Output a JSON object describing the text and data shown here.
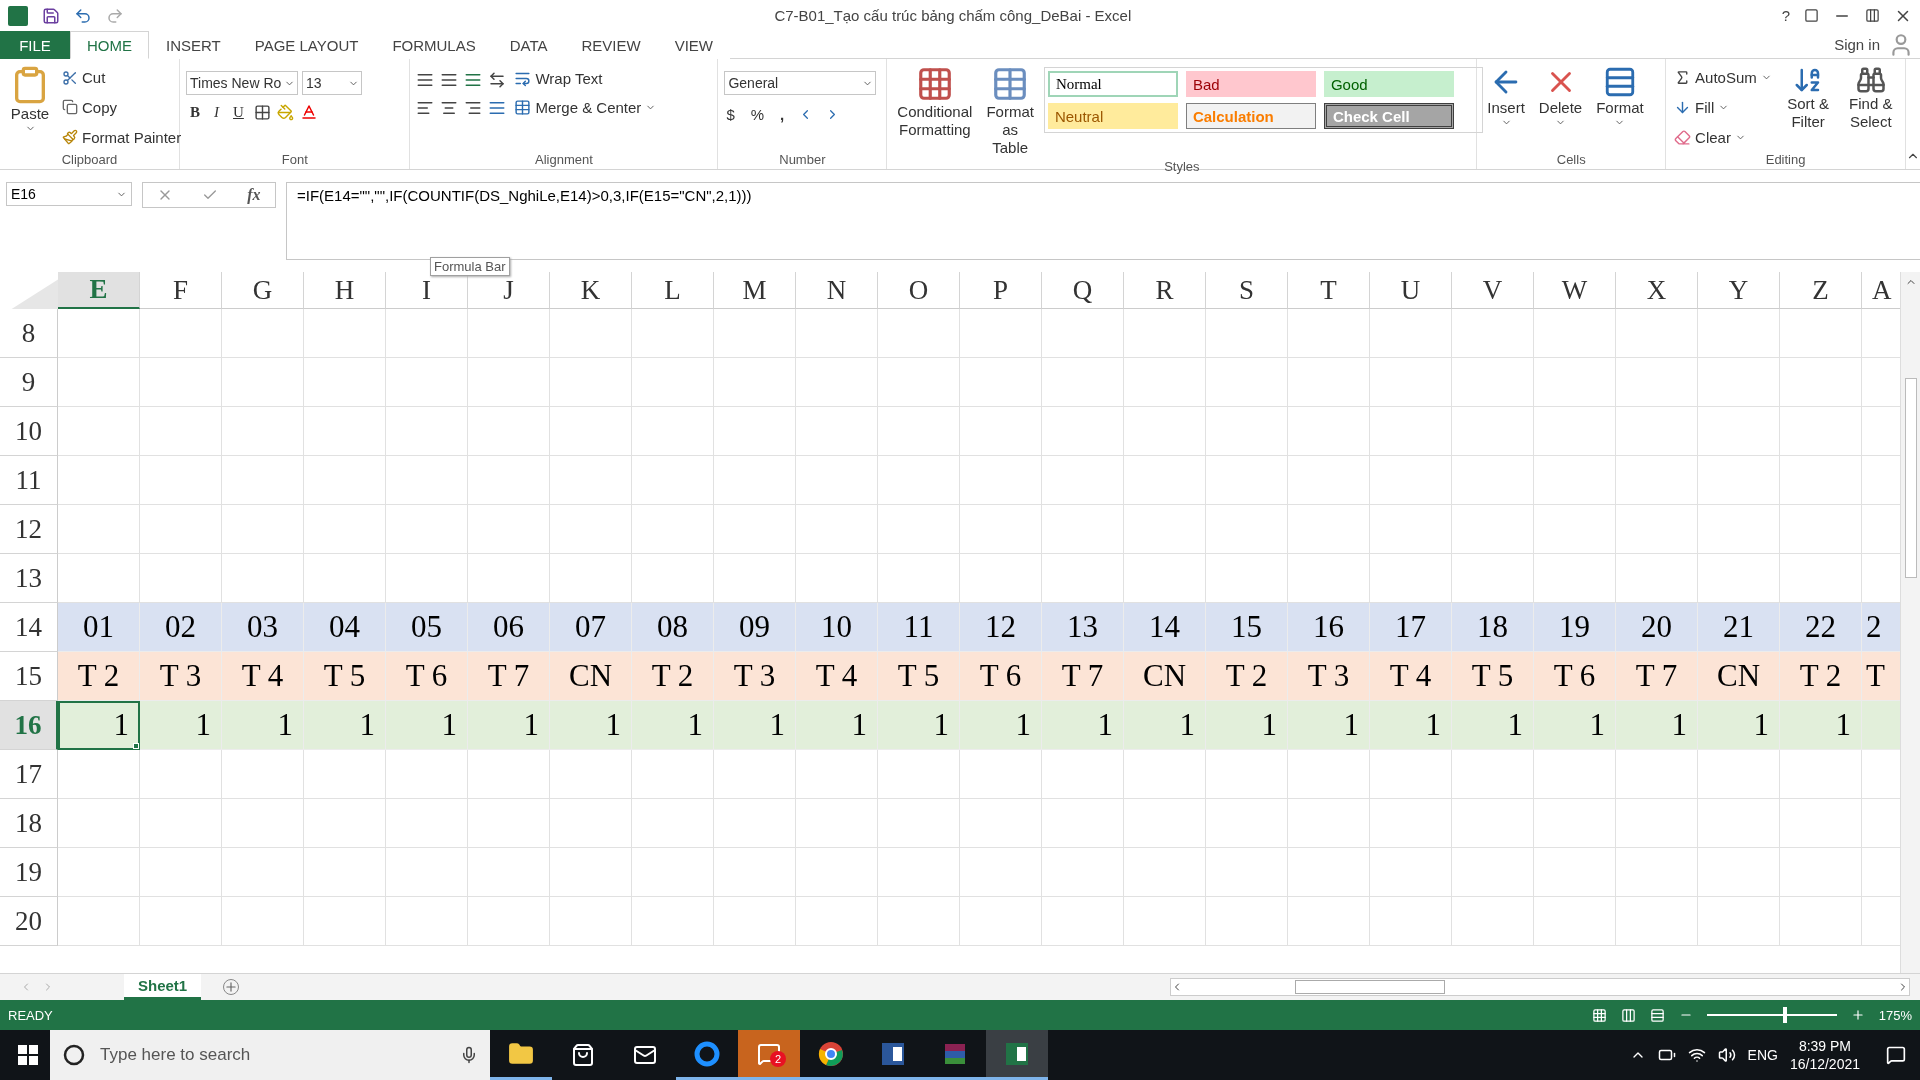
{
  "title_bar": {
    "title": "C7-B01_Tạo cấu trúc bảng chấm công_DeBai - Excel",
    "help": "?",
    "sign_in": "Sign in"
  },
  "ribbon_tabs": [
    {
      "label": "FILE",
      "kind": "file",
      "selected": false
    },
    {
      "label": "HOME",
      "kind": "tab",
      "selected": true
    },
    {
      "label": "INSERT",
      "kind": "tab",
      "selected": false
    },
    {
      "label": "PAGE LAYOUT",
      "kind": "tab",
      "selected": false
    },
    {
      "label": "FORMULAS",
      "kind": "tab",
      "selected": false
    },
    {
      "label": "DATA",
      "kind": "tab",
      "selected": false
    },
    {
      "label": "REVIEW",
      "kind": "tab",
      "selected": false
    },
    {
      "label": "VIEW",
      "kind": "tab",
      "selected": false
    }
  ],
  "ribbon": {
    "clipboard": {
      "label": "Clipboard",
      "paste": "Paste",
      "cut": "Cut",
      "copy": "Copy",
      "format_painter": "Format Painter"
    },
    "font": {
      "label": "Font",
      "name": "Times New Ro",
      "size": "13",
      "bold": "B",
      "italic": "I",
      "underline": "U"
    },
    "alignment": {
      "label": "Alignment",
      "wrap_text": "Wrap Text",
      "merge": "Merge & Center"
    },
    "number": {
      "label": "Number",
      "format": "General",
      "currency": "$",
      "percent": "%",
      "comma": ","
    },
    "styles": {
      "label": "Styles",
      "conditional": "Conditional Formatting",
      "format_table": "Format as Table",
      "gallery": [
        {
          "label": "Normal",
          "kind": "normal"
        },
        {
          "label": "Bad",
          "kind": "bad"
        },
        {
          "label": "Good",
          "kind": "good"
        },
        {
          "label": "Neutral",
          "kind": "neutral"
        },
        {
          "label": "Calculation",
          "kind": "calculation"
        },
        {
          "label": "Check Cell",
          "kind": "check"
        }
      ]
    },
    "cells": {
      "label": "Cells",
      "buttons": [
        {
          "label": "Insert",
          "kind": "insert"
        },
        {
          "label": "Delete",
          "kind": "delete"
        },
        {
          "label": "Format",
          "kind": "format"
        }
      ]
    },
    "editing": {
      "label": "Editing",
      "autosum": "AutoSum",
      "fill": "Fill",
      "clear": "Clear",
      "sort": "Sort & Filter",
      "find": "Find & Select"
    }
  },
  "formula_bar": {
    "name_box": "E16",
    "formula": "=IF(E14=\"\",\"\",IF(COUNTIF(DS_NghiLe,E14)>0,3,IF(E15=\"CN\",2,1)))",
    "tooltip": "Formula Bar",
    "function_symbol": "fx"
  },
  "sheet": {
    "columns": [
      {
        "label": "E",
        "selected": true
      },
      {
        "label": "F",
        "selected": false
      },
      {
        "label": "G",
        "selected": false
      },
      {
        "label": "H",
        "selected": false
      },
      {
        "label": "I",
        "selected": false
      },
      {
        "label": "J",
        "selected": false
      },
      {
        "label": "K",
        "selected": false
      },
      {
        "label": "L",
        "selected": false
      },
      {
        "label": "M",
        "selected": false
      },
      {
        "label": "N",
        "selected": false
      },
      {
        "label": "O",
        "selected": false
      },
      {
        "label": "P",
        "selected": false
      },
      {
        "label": "Q",
        "selected": false
      },
      {
        "label": "R",
        "selected": false
      },
      {
        "label": "S",
        "selected": false
      },
      {
        "label": "T",
        "selected": false
      },
      {
        "label": "U",
        "selected": false
      },
      {
        "label": "V",
        "selected": false
      },
      {
        "label": "W",
        "selected": false
      },
      {
        "label": "X",
        "selected": false
      },
      {
        "label": "Y",
        "selected": false
      },
      {
        "label": "Z",
        "selected": false
      },
      {
        "label": "A",
        "selected": false
      }
    ],
    "rows": [
      {
        "label": "8",
        "selected": false
      },
      {
        "label": "9",
        "selected": false
      },
      {
        "label": "10",
        "selected": false
      },
      {
        "label": "11",
        "selected": false
      },
      {
        "label": "12",
        "selected": false
      },
      {
        "label": "13",
        "selected": false
      },
      {
        "label": "14",
        "selected": false,
        "kind": "text",
        "color": "#d9e1f2",
        "cells": [
          "01",
          "02",
          "03",
          "04",
          "05",
          "06",
          "07",
          "08",
          "09",
          "10",
          "11",
          "12",
          "13",
          "14",
          "15",
          "16",
          "17",
          "18",
          "19",
          "20",
          "21",
          "22",
          "2"
        ]
      },
      {
        "label": "15",
        "selected": false,
        "kind": "text",
        "color": "#fce4d6",
        "cells": [
          "T 2",
          "T 3",
          "T 4",
          "T 5",
          "T 6",
          "T 7",
          "CN",
          "T 2",
          "T 3",
          "T 4",
          "T 5",
          "T 6",
          "T 7",
          "CN",
          "T 2",
          "T 3",
          "T 4",
          "T 5",
          "T 6",
          "T 7",
          "CN",
          "T 2",
          "T"
        ]
      },
      {
        "label": "16",
        "selected": true,
        "kind": "number",
        "color": "#e2efda",
        "cells": [
          "1",
          "1",
          "1",
          "1",
          "1",
          "1",
          "1",
          "1",
          "1",
          "1",
          "1",
          "1",
          "1",
          "1",
          "1",
          "1",
          "1",
          "1",
          "1",
          "1",
          "1",
          "1"
        ]
      },
      {
        "label": "17",
        "selected": false
      },
      {
        "label": "18",
        "selected": false
      },
      {
        "label": "19",
        "selected": false
      },
      {
        "label": "20",
        "selected": false
      }
    ]
  },
  "sheet_tabs": [
    {
      "label": "Sheet1",
      "selected": true
    }
  ],
  "status_bar": {
    "status": "READY",
    "zoom": "175%",
    "zoom_slider": {
      "level": 0.6
    }
  },
  "taskbar": {
    "search_placeholder": "Type here to search",
    "badge": "2",
    "language": "ENG",
    "time": "8:39 PM",
    "date": "16/12/2021"
  }
}
